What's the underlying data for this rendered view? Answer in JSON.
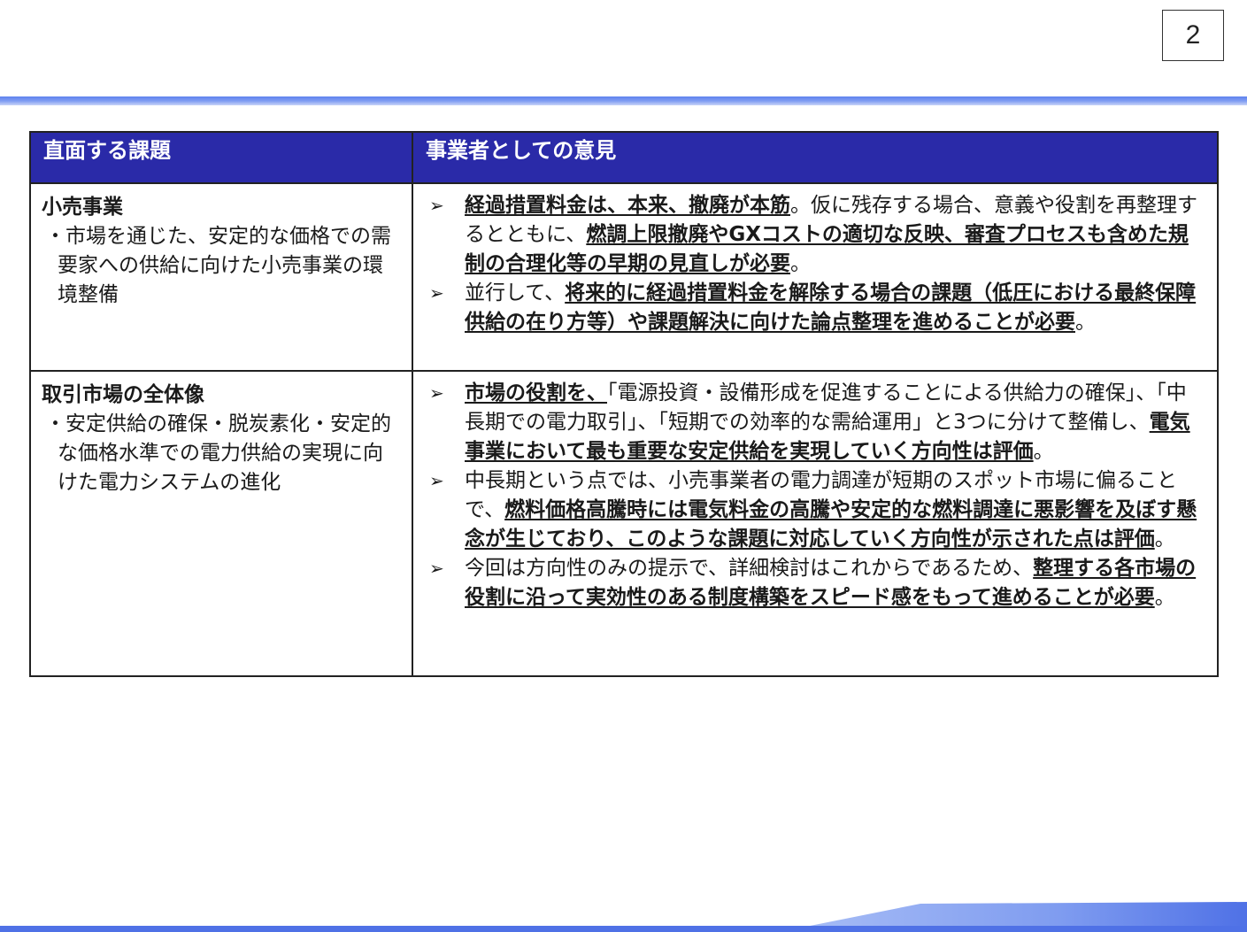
{
  "page_number": "2",
  "table": {
    "headers": [
      "直面する課題",
      "事業者としての意見"
    ],
    "rows": [
      {
        "category": "小売事業",
        "description": "・市場を通じた、安定的な価格での需要家への供給に向けた小売事業の環境整備",
        "opinions": [
          [
            {
              "text": "経過措置料金は、本来、撤廃が本筋",
              "bold": true
            },
            {
              "text": "。仮に残存する場合、意義や役割を再整理するとともに、",
              "bold": false
            },
            {
              "text": "燃調上限撤廃やGXコストの適切な反映、審査プロセスも含めた規制の合理化等の早期の見直しが必要",
              "bold": true
            },
            {
              "text": "。",
              "bold": false
            }
          ],
          [
            {
              "text": "並行して、",
              "bold": false
            },
            {
              "text": "将来的に経過措置料金を解除する場合の課題（低圧における最終保障供給の在り方等）や課題解決に向けた論点整理を進めることが必要",
              "bold": true
            },
            {
              "text": "。",
              "bold": false
            }
          ]
        ]
      },
      {
        "category": "取引市場の全体像",
        "description": "・安定供給の確保・脱炭素化・安定的な価格水準での電力供給の実現に向けた電力システムの進化",
        "opinions": [
          [
            {
              "text": "市場の役割を、",
              "bold": true
            },
            {
              "text": "「電源投資・設備形成を促進することによる供給力の確保」、「中長期での電力取引」、「短期での効率的な需給運用」と3つに分けて整備し、",
              "bold": false
            },
            {
              "text": "電気事業において最も重要な安定供給を実現していく方向性は評価",
              "bold": true
            },
            {
              "text": "。",
              "bold": false
            }
          ],
          [
            {
              "text": "中長期という点では、小売事業者の電力調達が短期のスポット市場に偏ることで、",
              "bold": false
            },
            {
              "text": "燃料価格高騰時には電気料金の高騰や安定的な燃料調達に悪影響を及ぼす懸念が生じており、このような課題に対応していく方向性が示された点は評価",
              "bold": true
            },
            {
              "text": "。",
              "bold": false
            }
          ],
          [
            {
              "text": "今回は方向性のみの提示で、詳細検討はこれからであるため、",
              "bold": false
            },
            {
              "text": "整理する各市場の役割に沿って実効性のある制度構築をスピード感をもって進めることが必要",
              "bold": true
            },
            {
              "text": "。",
              "bold": false
            }
          ]
        ]
      }
    ]
  },
  "colors": {
    "header_bg": "#2a2aa8",
    "header_text": "#ffffff",
    "accent_line": "#5f82ee"
  },
  "icons": {
    "bullet": "arrowhead-bullet-icon"
  }
}
